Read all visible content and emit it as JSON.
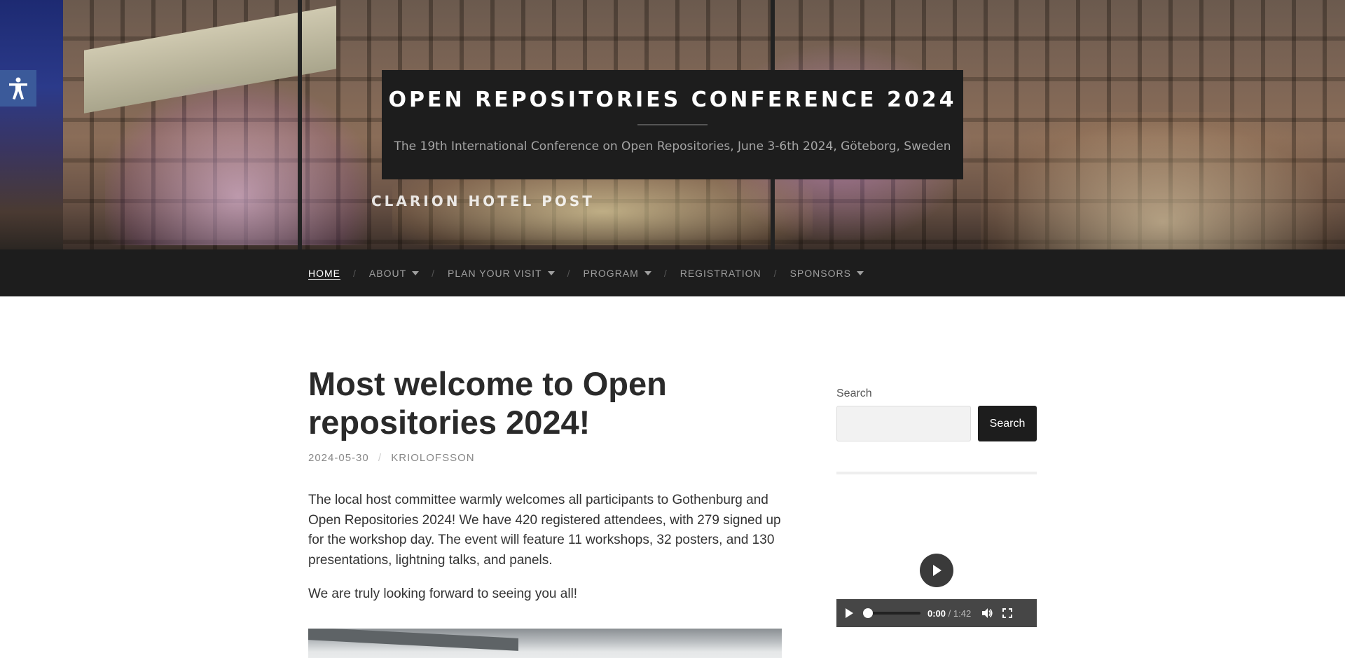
{
  "site": {
    "title": "OPEN REPOSITORIES CONFERENCE 2024",
    "description": "The 19th International Conference on Open Repositories, June 3-6th 2024, Göteborg, Sweden",
    "hero_sign": "CLARION HOTEL POST"
  },
  "accessibility": {
    "icon": "accessibility-icon"
  },
  "nav": {
    "items": [
      {
        "label": "HOME",
        "current": true,
        "has_submenu": false
      },
      {
        "label": "ABOUT",
        "current": false,
        "has_submenu": true
      },
      {
        "label": "PLAN YOUR VISIT",
        "current": false,
        "has_submenu": true
      },
      {
        "label": "PROGRAM",
        "current": false,
        "has_submenu": true
      },
      {
        "label": "REGISTRATION",
        "current": false,
        "has_submenu": false
      },
      {
        "label": "SPONSORS",
        "current": false,
        "has_submenu": true
      }
    ],
    "separator": "/"
  },
  "post": {
    "title": "Most welcome to Open repositories 2024!",
    "date": "2024-05-30",
    "author": "KRIOLOFSSON",
    "meta_separator": "/",
    "paragraphs": [
      "The local host committee warmly welcomes all participants to Gothenburg and Open Repositories 2024! We have 420 registered attendees, with 279 signed up for the workshop day. The event will feature 11 workshops, 32 posters, and 130 presentations, lightning talks, and panels.",
      "We are truly looking forward to seeing you all!"
    ]
  },
  "sidebar": {
    "search": {
      "label": "Search",
      "placeholder": "",
      "value": "",
      "button": "Search"
    },
    "video": {
      "current_time": "0:00",
      "separator": "/",
      "duration": "1:42",
      "progress": 0
    }
  },
  "colors": {
    "dark": "#1d1d1d",
    "nav_text": "#a0a0a0",
    "accessibility_bg": "#3b5a9a"
  }
}
